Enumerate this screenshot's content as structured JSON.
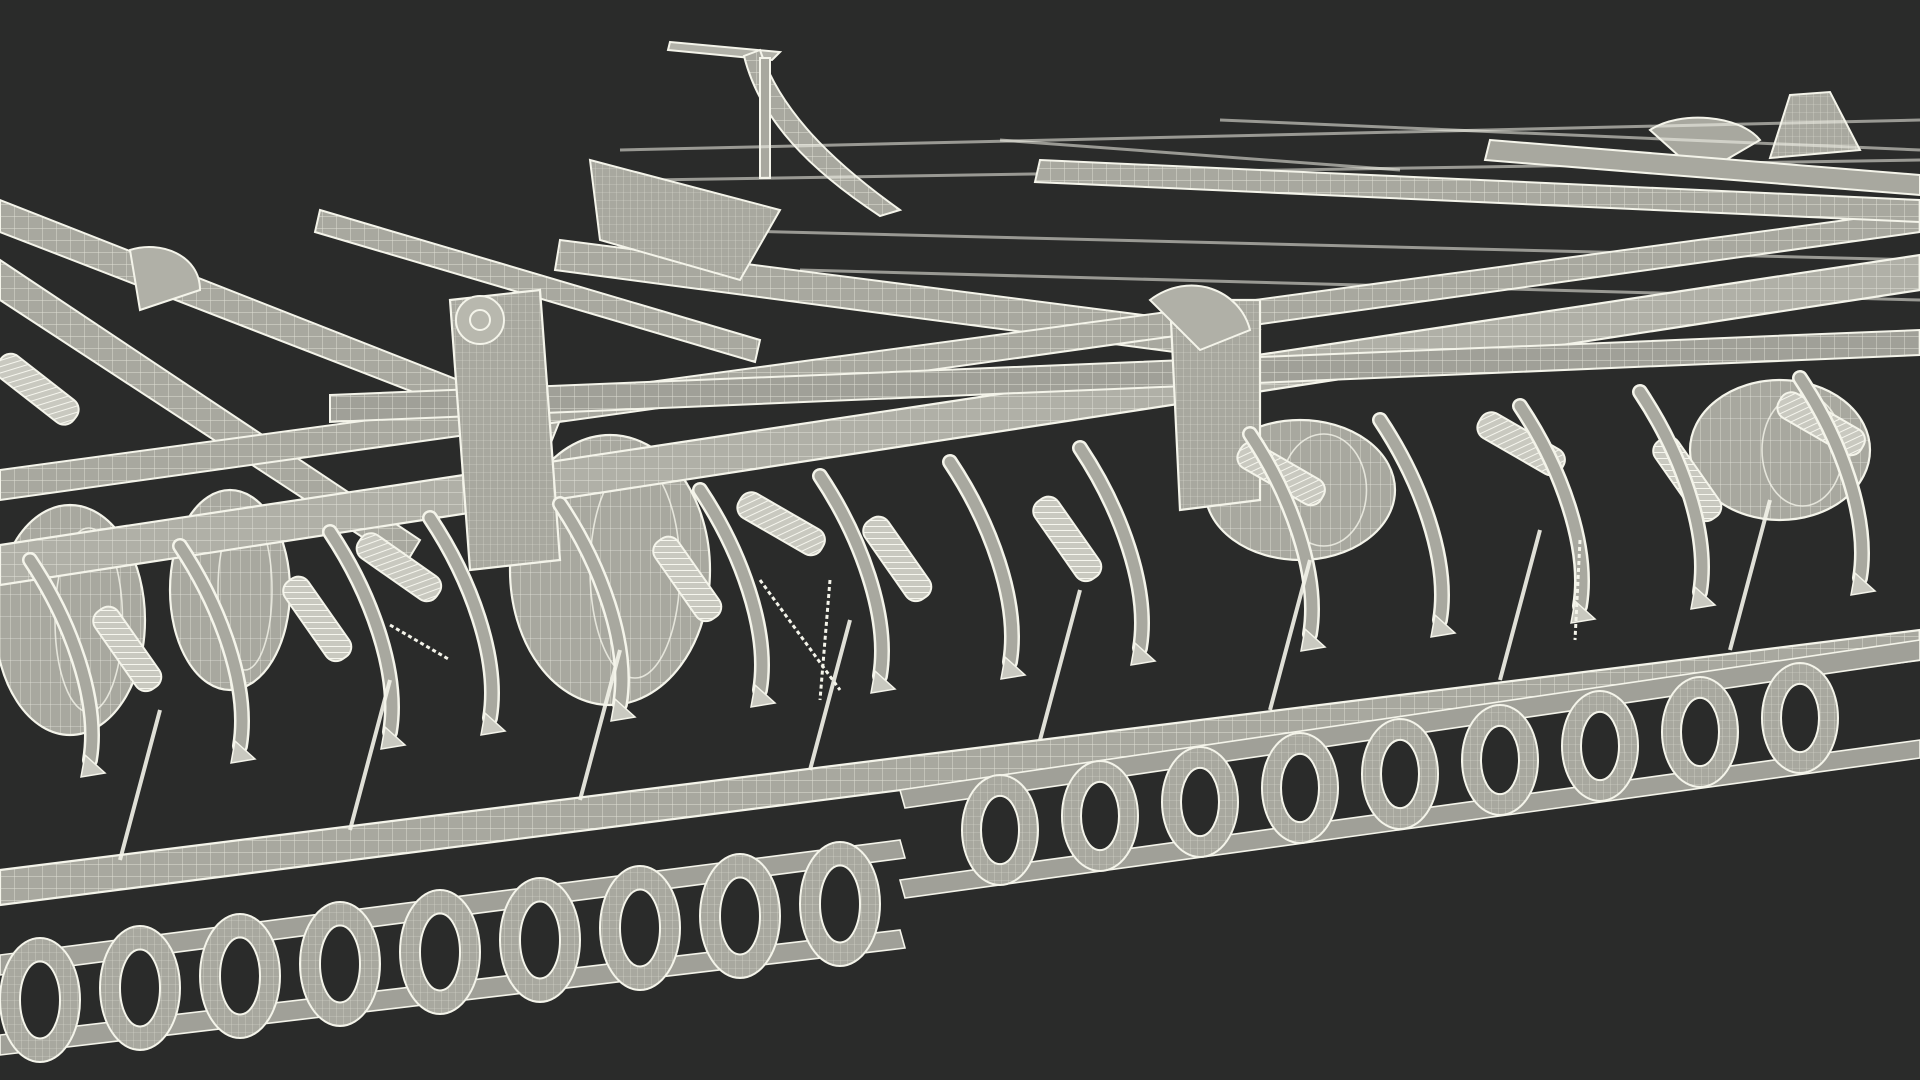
{
  "scene": {
    "subject": "wireframe-render-field-cultivator",
    "colors": {
      "background": "#2a2b2a",
      "frame_fill": "#a8a89f",
      "frame_light": "#c9c9c0",
      "wire": "#f4f4ea",
      "wire_dim": "#8a8a82",
      "shadow": "#74746c"
    },
    "counts": {
      "front_wheels": 3,
      "rear_wheels": 2,
      "coil_springs": 12,
      "shanks": 14,
      "front_basket_blades": 9,
      "rear_basket_blades": 9
    }
  }
}
